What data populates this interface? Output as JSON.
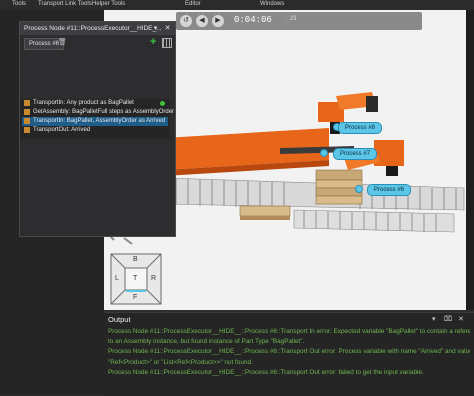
{
  "ribbon": {
    "tabs": [
      "Tools",
      "Transport Link Tools",
      "Helper Tools",
      "Editor",
      "Windows"
    ]
  },
  "media": {
    "time": "0:04:06",
    "speed": "· 23"
  },
  "panel": {
    "title": "Process Node #11::ProcessExecutor__HIDE_...",
    "tab": "Process #6",
    "steps": [
      {
        "label": "TransportIn: Any product as BagPallet",
        "selected": false
      },
      {
        "label": "GetAssembly: BagPalletFull steps as AssemblyOrder",
        "selected": false
      },
      {
        "label": "TransportIn: BagPallet, AssemblyOrder as Arrived",
        "selected": true
      },
      {
        "label": "TransportOut: Arrived",
        "selected": false
      }
    ]
  },
  "scene": {
    "labels": [
      "Process #8",
      "Process #7",
      "Process #6"
    ]
  },
  "navcube": {
    "faces": {
      "top": "B",
      "left": "L",
      "right": "R",
      "bottom": "F",
      "center": "T"
    }
  },
  "output": {
    "title": "Output",
    "lines": [
      "Process Node #11::ProcessExecutor__HIDE__::Process #6::Transport In error: Expected variable \"BagPallet\" to contain a reference",
      "to an Assembly instance, but found instance of Part Type \"BagPallet\".",
      "Process Node #11::ProcessExecutor__HIDE__::Process #6::Transport Out error: Process variable with name \"Arrived\" and value type",
      "\"Ref<Product>\" or \"List<Ref<Product>>\" not found.",
      "Process Node #11::ProcessExecutor__HIDE__::Process #6::Transport Out error: failed to get the input variable."
    ]
  },
  "colors": {
    "accent": "#5bc6e8",
    "output_text": "#6fb64d",
    "robot": "#e8661a"
  }
}
